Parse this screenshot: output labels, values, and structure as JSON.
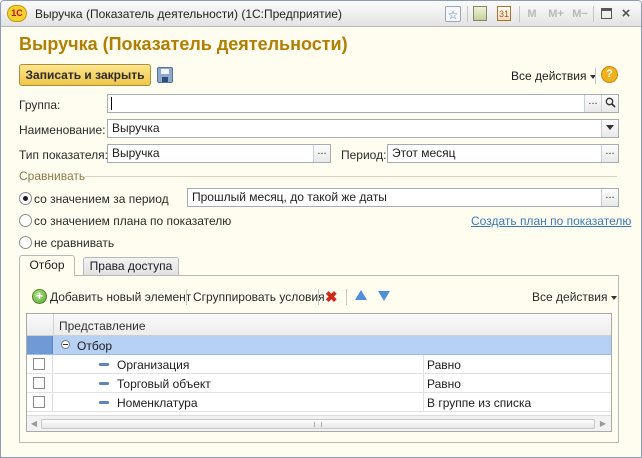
{
  "window": {
    "title": "Выручка (Показатель деятельности)  (1С:Предприятие)",
    "logo": "1С"
  },
  "icons": {
    "favorite": "star-icon",
    "calculator": "calculator-icon",
    "calendar": "calendar-icon",
    "memory": [
      "M",
      "M+",
      "M−"
    ],
    "restore": "restore-window-icon",
    "close": "close-icon"
  },
  "form": {
    "heading": "Выручка (Показатель деятельности)",
    "save_close_label": "Записать и закрыть",
    "all_actions_label": "Все действия",
    "help_label": "?",
    "group_label": "Группа:",
    "group_value": "",
    "name_label": "Наименование:",
    "name_value": "Выручка",
    "type_label": "Тип показателя:",
    "type_value": "Выручка",
    "period_label": "Период:",
    "period_value": "Этот месяц",
    "compare_group_label": "Сравнивать",
    "compare_options": [
      {
        "label": "со значением за период",
        "selected": true
      },
      {
        "label": "со значением плана по показателю",
        "selected": false
      },
      {
        "label": "не сравнивать",
        "selected": false
      }
    ],
    "compare_period_value": "Прошлый месяц, до такой же даты",
    "create_plan_link": "Создать план по показателю",
    "select_button": "...",
    "search_icon": "magnifier-icon"
  },
  "tabs": [
    {
      "label": "Отбор",
      "active": true
    },
    {
      "label": "Права доступа",
      "active": false
    }
  ],
  "filter_toolbar": {
    "add_label": "Добавить новый элемент",
    "group_label": "Сгруппировать условия",
    "all_actions_label": "Все действия"
  },
  "grid": {
    "header": "Представление",
    "group_row": "Отбор",
    "rows": [
      {
        "name": "Организация",
        "condition": "Равно"
      },
      {
        "name": "Торговый объект",
        "condition": "Равно"
      },
      {
        "name": "Номенклатура",
        "condition": "В группе из списка"
      }
    ]
  },
  "colors": {
    "heading": "#b17f00",
    "accent_button": "#efc648",
    "selection": "#b6d1f3",
    "link": "#3c78b4"
  }
}
